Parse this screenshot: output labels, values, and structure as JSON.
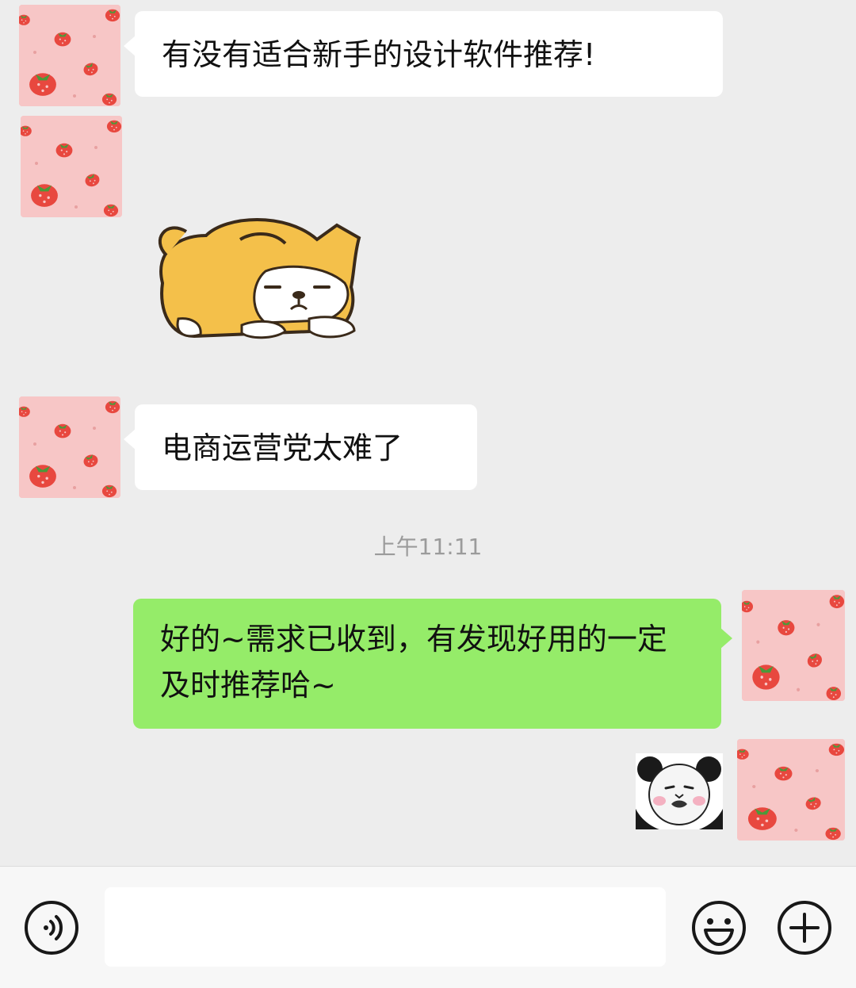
{
  "messages": [
    {
      "side": "in",
      "text": "有没有适合新手的设计软件推荐!"
    },
    {
      "side": "in",
      "type": "sticker",
      "sticker": "sleepy-shiba-sticker"
    },
    {
      "side": "in",
      "text": "电商运营党太难了"
    },
    {
      "side": "out",
      "text": "好的~需求已收到，有发现好用的一定及时推荐哈~"
    },
    {
      "side": "out",
      "type": "sticker",
      "sticker": "panda-face-meme-sticker"
    }
  ],
  "timestamp": "上午11:11",
  "input": {
    "value": "",
    "voice_icon": "voice-icon",
    "emoji_icon": "emoji-icon",
    "plus_icon": "plus-icon"
  },
  "colors": {
    "background": "#ededed",
    "incoming_bubble": "#ffffff",
    "outgoing_bubble": "#95ec69",
    "avatar_pink": "#f7c6c6",
    "strawberry_red": "#e8483f"
  }
}
